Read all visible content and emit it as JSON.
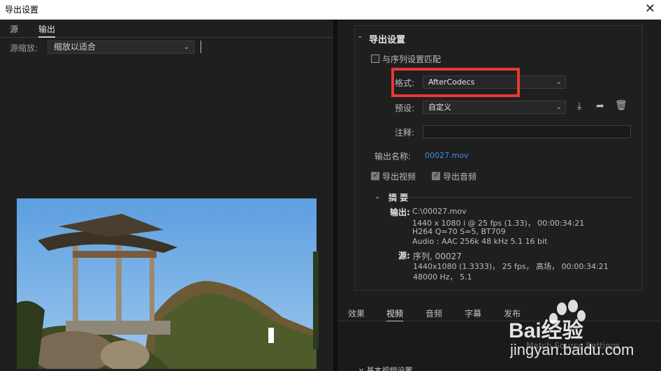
{
  "window": {
    "title": "导出设置",
    "close_glyph": "✕"
  },
  "left": {
    "tabs": [
      {
        "label": "源"
      },
      {
        "label": "输出"
      }
    ],
    "zoom_label": "源缩放:",
    "zoom_value": "缩放以适合"
  },
  "export_settings": {
    "section_title": "导出设置",
    "match_sequence": {
      "label": "与序列设置匹配",
      "checked": false
    },
    "format": {
      "label": "格式:",
      "value": "AfterCodecs"
    },
    "preset": {
      "label": "预设:",
      "value": "自定义"
    },
    "comments": {
      "label": "注释:",
      "value": ""
    },
    "output_name": {
      "label": "输出名称:",
      "value": "00027.mov"
    },
    "export_video": {
      "label": "导出视频",
      "checked": true
    },
    "export_audio": {
      "label": "导出音频",
      "checked": true
    }
  },
  "summary": {
    "title": "摘 要",
    "output_key": "输出:",
    "output_lines": [
      "C:\\00027.mov",
      "1440 x 1080 i @ 25 fps (1.33)， 00:00:34:21",
      "H264 Q=70 S=5, BT709",
      "Audio : AAC 256k 48 kHz 5.1 16 bit"
    ],
    "source_key": "源:",
    "source_lines": [
      "序列, 00027",
      "1440x1080 (1.3333)， 25 fps， 高场， 00:00:34:21",
      "48000 Hz， 5.1"
    ]
  },
  "bottom_tabs": [
    {
      "label": "效果"
    },
    {
      "label": "视频"
    },
    {
      "label": "音频"
    },
    {
      "label": "字幕"
    },
    {
      "label": "发布"
    }
  ],
  "bottom": {
    "ghost_button": "Match Source Settings",
    "row_label": "∨ 基本视频设置"
  },
  "watermark": {
    "line1": "Bai经验",
    "line2": "jingyan.baidu.com"
  },
  "colors": {
    "accent_link": "#3d8fe0",
    "highlight_box": "#e53935"
  }
}
